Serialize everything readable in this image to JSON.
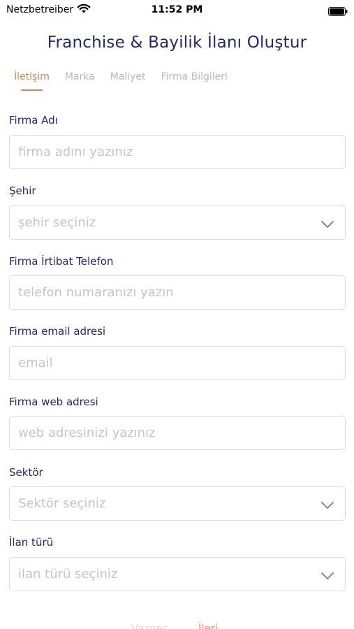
{
  "status_bar": {
    "carrier": "Netzbetreiber",
    "time": "11:52 PM"
  },
  "page": {
    "title": "Franchise & Bayilik İlanı Oluştur"
  },
  "tabs": [
    {
      "label": "İletişim",
      "active": true
    },
    {
      "label": "Marka",
      "active": false
    },
    {
      "label": "Maliyet",
      "active": false
    },
    {
      "label": "Firma Bilgileri",
      "active": false
    }
  ],
  "form": {
    "fields": [
      {
        "label": "Firma Adı",
        "placeholder": "firma adını yazınız",
        "type": "text"
      },
      {
        "label": "Şehir",
        "placeholder": "şehir seçiniz",
        "type": "select"
      },
      {
        "label": "Firma İrtibat Telefon",
        "placeholder": "telefon numaranızı yazın",
        "type": "text"
      },
      {
        "label": "Firma email adresi",
        "placeholder": "email",
        "type": "text"
      },
      {
        "label": "Firma web adresi",
        "placeholder": "web adresinizi yazınız",
        "type": "text"
      },
      {
        "label": "Sektör",
        "placeholder": "Sektör seçiniz",
        "type": "select"
      },
      {
        "label": "İlan türü",
        "placeholder": "ilan türü seçiniz",
        "type": "select"
      }
    ]
  },
  "actions": {
    "cancel_label": "Vazgeç",
    "next_label": "İleri"
  },
  "colors": {
    "title": "#1f2a66",
    "accent": "#c58b55",
    "next": "#e89070",
    "border": "#d9dbe0",
    "placeholder": "#c4c4c9"
  }
}
